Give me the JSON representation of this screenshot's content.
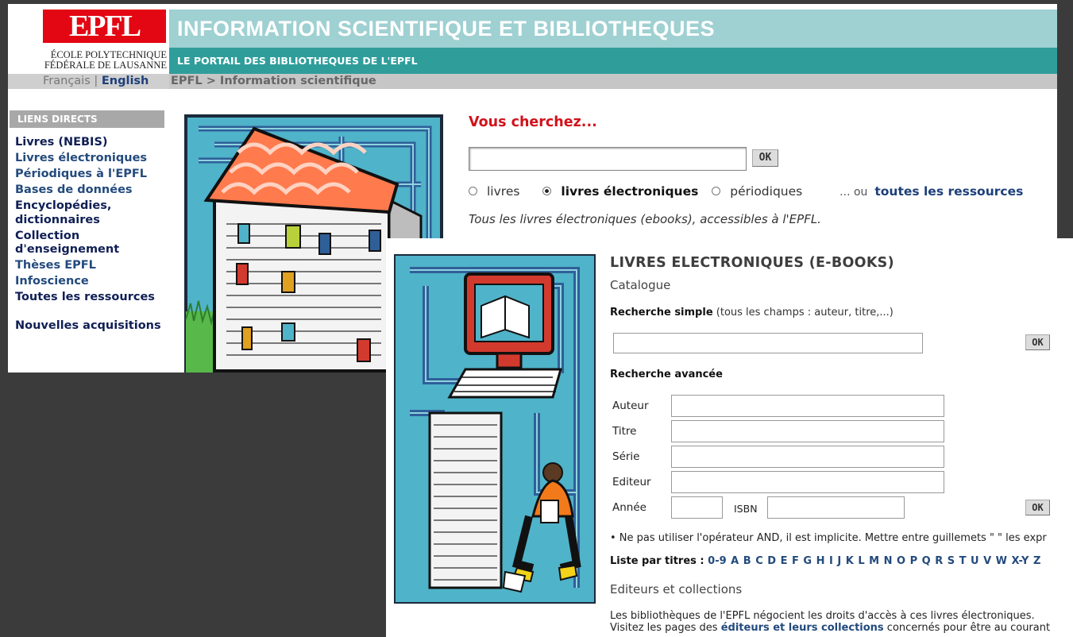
{
  "portal": {
    "logo": "EPFL",
    "logo_sub_1": "ÉCOLE POLYTECHNIQUE",
    "logo_sub_2": "FÉDÉRALE DE LAUSANNE",
    "title": "INFORMATION SCIENTIFIQUE ET BIBLIOTHEQUES",
    "subtitle": "LE PORTAIL DES BIBLIOTHEQUES DE L'EPFL",
    "lang_fr": "Français",
    "lang_sep": "|",
    "lang_en": "English",
    "breadcrumb": "EPFL > Information scientifique",
    "side_heading": "LIENS DIRECTS",
    "side_links": [
      "Livres (NEBIS)",
      "Livres électroniques",
      "Périodiques à l'EPFL",
      "Bases de données",
      "Encyclopédies, dictionnaires",
      "Collection d'enseignement",
      "Thèses EPFL",
      "Infoscience",
      "Toutes les ressources",
      "Nouvelles acquisitions"
    ],
    "search_title": "Vous cherchez...",
    "search_value": "",
    "ok": "OK",
    "radio_livres": "livres",
    "radio_ebooks": "livres électroniques",
    "radio_periodiques": "périodiques",
    "ou_text": "... ou",
    "all_resources": "toutes les ressources",
    "helper": "Tous les livres électroniques (ebooks), accessibles à l'EPFL."
  },
  "ebooks": {
    "title": "LIVRES ELECTRONIQUES (E-BOOKS)",
    "catalogue": "Catalogue",
    "simple_bold": "Recherche simple",
    "simple_rest": " (tous les champs : auteur, titre,...)",
    "ok": "OK",
    "advanced": "Recherche avancée",
    "labels": {
      "auteur": "Auteur",
      "titre": "Titre",
      "serie": "Série",
      "editeur": "Editeur",
      "annee": "Année",
      "isbn": "ISBN"
    },
    "note": "• Ne pas utiliser l'opérateur AND, il est implicite. Mettre entre guillemets \" \" les expr",
    "list_label": "Liste par titres :",
    "letters": "0-9 A B C D E F G H I J K L M N O P Q R S T U V W X-Y Z",
    "publishers_heading": "Editeurs et collections",
    "para_line1": "Les bibliothèques de l'EPFL négocient les droits d'accès à ces livres électroniques.",
    "para_line2_a": "Visitez les pages des ",
    "para_link": "éditeurs et leurs collections",
    "para_line2_b": " concernés pour être au courant"
  }
}
